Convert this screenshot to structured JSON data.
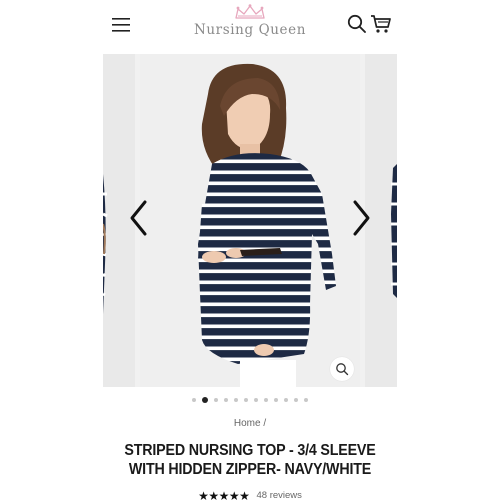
{
  "header": {
    "brand_name": "Nursing Queen",
    "brand_color": "#e7a7bd",
    "menu_icon": "hamburger-icon",
    "search_icon": "search-icon",
    "cart_icon": "cart-icon"
  },
  "gallery": {
    "total_images": 12,
    "active_index": 1,
    "prev_icon": "chevron-left-icon",
    "next_icon": "chevron-right-icon",
    "zoom_icon": "magnify-icon",
    "stripe_colors": {
      "navy": "#1e2a44",
      "white": "#ffffff"
    }
  },
  "breadcrumb": {
    "home": "Home",
    "separator": "/"
  },
  "product": {
    "title_line1": "STRIPED NURSING TOP - 3/4 SLEEVE",
    "title_line2": "WITH HIDDEN ZIPPER- NAVY/WHITE",
    "rating": 5,
    "stars": "★★★★★",
    "review_count": "48 reviews"
  }
}
